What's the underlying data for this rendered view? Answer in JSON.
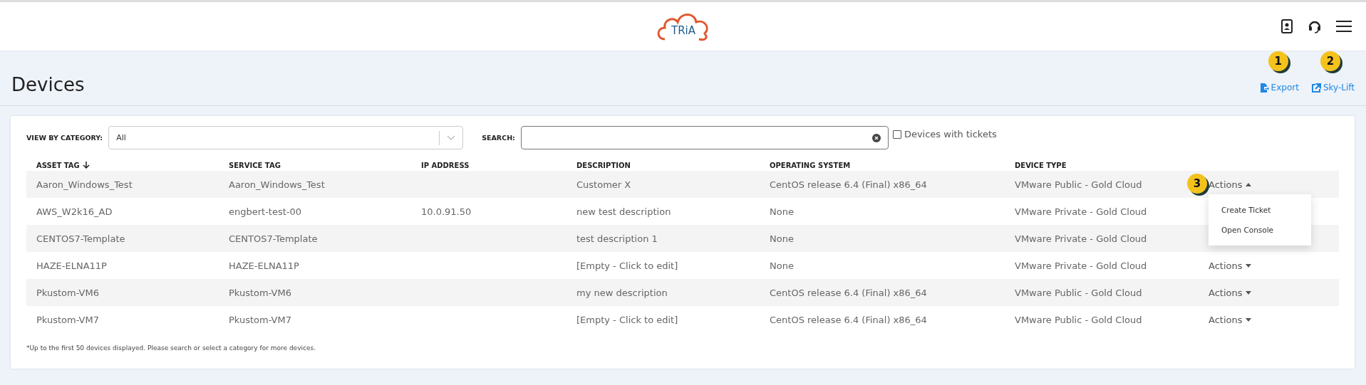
{
  "header": {
    "logo_text": "TRiA"
  },
  "page": {
    "title": "Devices"
  },
  "links": [
    {
      "label": "Export",
      "kind": "export",
      "badge": "1"
    },
    {
      "label": "Sky-Lift",
      "kind": "external",
      "badge": "2"
    }
  ],
  "filters": {
    "category_label": "VIEW BY CATEGORY:",
    "category_value": "All",
    "search_label": "SEARCH:",
    "tickets": {
      "label": "Devices with tickets",
      "checked": false
    }
  },
  "table": {
    "columns": [
      {
        "label": "ASSET TAG",
        "sorted": true
      },
      {
        "label": "SERVICE TAG",
        "sorted": false
      },
      {
        "label": "IP ADDRESS",
        "sorted": false
      },
      {
        "label": "DESCRIPTION",
        "sorted": false
      },
      {
        "label": "OPERATING SYSTEM",
        "sorted": false
      },
      {
        "label": "DEVICE TYPE",
        "sorted": false
      }
    ],
    "rows": [
      {
        "cells": [
          "Aaron_Windows_Test",
          "Aaron_Windows_Test",
          "",
          "Customer X",
          "CentOS release 6.4 (Final) x86_64",
          "VMware Public - Gold Cloud"
        ],
        "actions": {
          "label": "Actions",
          "expanded": true,
          "badge": "3",
          "menu": [
            "Create Ticket",
            "Open Console"
          ]
        }
      },
      {
        "cells": [
          "AWS_W2k16_AD",
          "engbert-test-00",
          "10.0.91.50",
          "new test description",
          "None",
          "VMware Private - Gold Cloud"
        ]
      },
      {
        "cells": [
          "CENTOS7-Template",
          "CENTOS7-Template",
          "",
          "test description 1",
          "None",
          "VMware Private - Gold Cloud"
        ]
      },
      {
        "cells": [
          "HAZE-ELNA11P",
          "HAZE-ELNA11P",
          "",
          "[Empty - Click to edit]",
          "None",
          "VMware Private - Gold Cloud"
        ],
        "actions": {
          "label": "Actions",
          "expanded": false
        }
      },
      {
        "cells": [
          "Pkustom-VM6",
          "Pkustom-VM6",
          "",
          "my new description",
          "CentOS release 6.4 (Final) x86_64",
          "VMware Public - Gold Cloud"
        ],
        "actions": {
          "label": "Actions",
          "expanded": false
        }
      },
      {
        "cells": [
          "Pkustom-VM7",
          "Pkustom-VM7",
          "",
          "[Empty - Click to edit]",
          "CentOS release 6.4 (Final) x86_64",
          "VMware Public - Gold Cloud"
        ],
        "actions": {
          "label": "Actions",
          "expanded": false
        }
      }
    ]
  },
  "footnote": "*Up to the first 50 devices displayed. Please search or select a category for more devices."
}
